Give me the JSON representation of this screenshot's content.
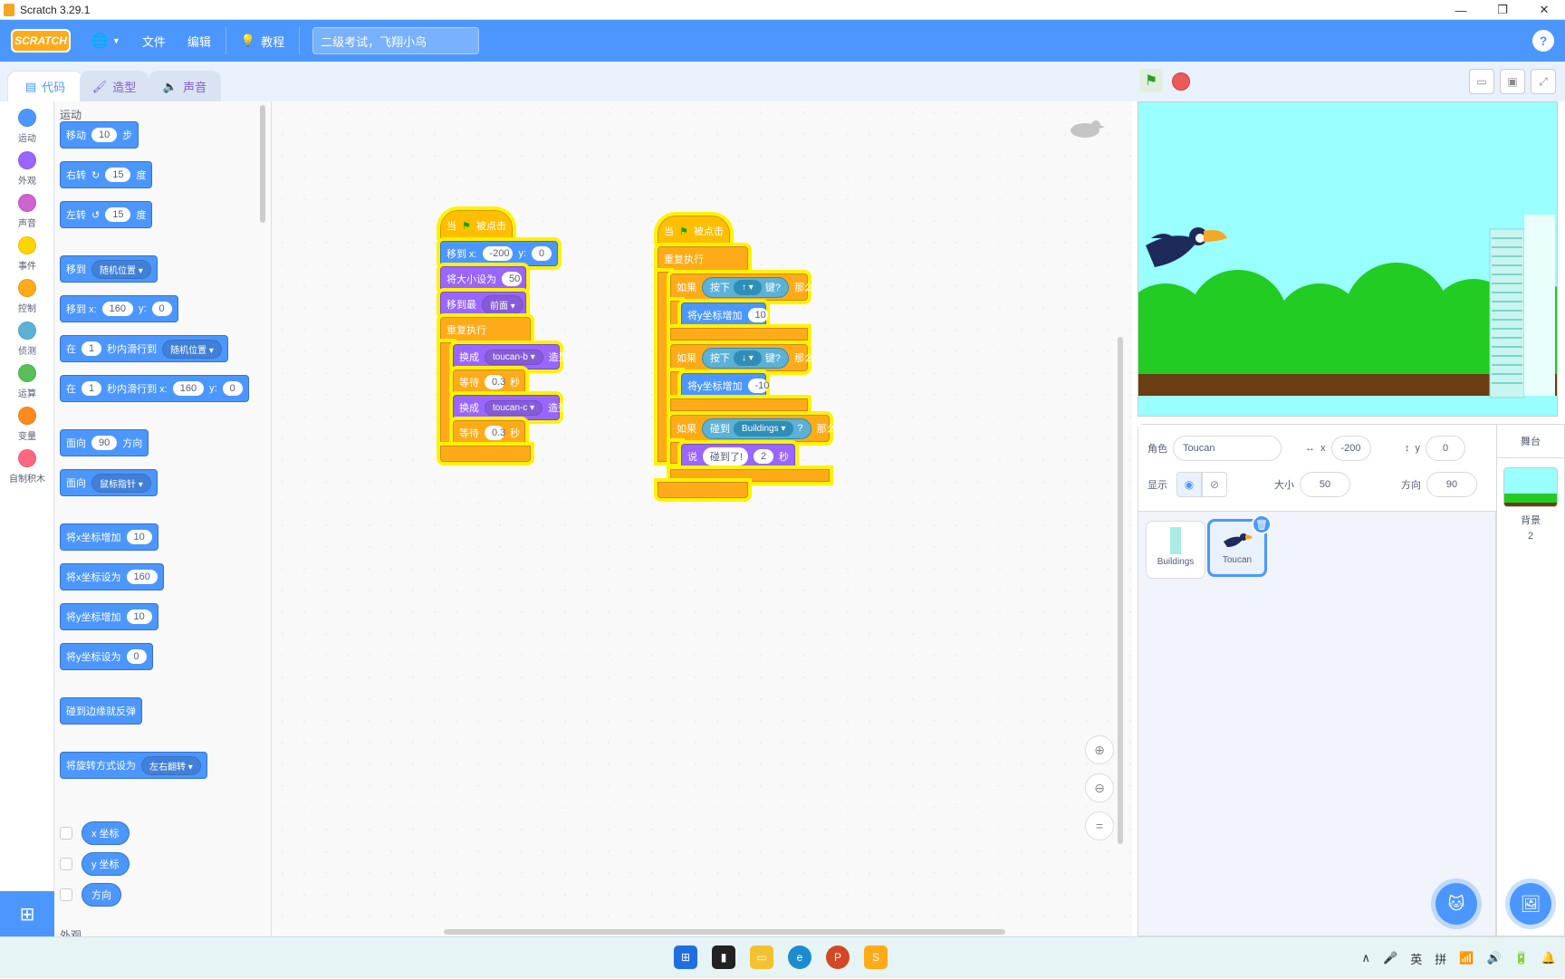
{
  "window": {
    "title": "Scratch 3.29.1",
    "controls": [
      "—",
      "❐",
      "✕"
    ]
  },
  "menubar": {
    "logo": "SCRATCH",
    "language_icon": "globe-icon",
    "file": "文件",
    "edit": "编辑",
    "tutorials": "教程",
    "project_title": "二级考试，飞翔小鸟",
    "help": "?"
  },
  "tabs": {
    "code": "代码",
    "costumes": "造型",
    "sounds": "声音"
  },
  "categories": [
    {
      "label": "运动",
      "color": "#4c97ff"
    },
    {
      "label": "外观",
      "color": "#9966ff"
    },
    {
      "label": "声音",
      "color": "#cf63cf"
    },
    {
      "label": "事件",
      "color": "#ffd500"
    },
    {
      "label": "控制",
      "color": "#ffab19"
    },
    {
      "label": "侦测",
      "color": "#5cb1d6"
    },
    {
      "label": "运算",
      "color": "#59c059"
    },
    {
      "label": "变量",
      "color": "#ff8c1a"
    },
    {
      "label": "自制积木",
      "color": "#ff6680"
    }
  ],
  "palette": {
    "heading": "运动",
    "move": {
      "pre": "移动",
      "val": "10",
      "post": "步"
    },
    "turn_right": {
      "pre": "右转",
      "val": "15",
      "post": "度"
    },
    "turn_left": {
      "pre": "左转",
      "val": "15",
      "post": "度"
    },
    "goto": {
      "pre": "移到",
      "drop": "随机位置"
    },
    "goto_xy": {
      "pre": "移到 x:",
      "x": "160",
      "mid": "y:",
      "y": "0"
    },
    "glide": {
      "pre": "在",
      "val": "1",
      "mid": "秒内滑行到",
      "drop": "随机位置"
    },
    "glide_xy": {
      "pre": "在",
      "val": "1",
      "mid": "秒内滑行到 x:",
      "x": "160",
      "ylab": "y:",
      "y": "0"
    },
    "point_dir": {
      "pre": "面向",
      "val": "90",
      "post": "方向"
    },
    "point_towards": {
      "pre": "面向",
      "drop": "鼠标指针"
    },
    "change_x": {
      "pre": "将x坐标增加",
      "val": "10"
    },
    "set_x": {
      "pre": "将x坐标设为",
      "val": "160"
    },
    "change_y": {
      "pre": "将y坐标增加",
      "val": "10"
    },
    "set_y": {
      "pre": "将y坐标设为",
      "val": "0"
    },
    "bounce": "碰到边缘就反弹",
    "rotation_style": {
      "pre": "将旋转方式设为",
      "drop": "左右翻转"
    },
    "rep_x": "x 坐标",
    "rep_y": "y 坐标",
    "rep_dir": "方向",
    "next_heading": "外观"
  },
  "script1": {
    "hat": {
      "pre": "当",
      "post": "被点击"
    },
    "goto": {
      "pre": "移到 x:",
      "x": "-200",
      "mid": "y:",
      "y": "0"
    },
    "size": {
      "pre": "将大小设为",
      "val": "50"
    },
    "layer": {
      "pre": "移到最",
      "drop": "前面"
    },
    "forever": "重复执行",
    "costume1": {
      "pre": "换成",
      "drop": "toucan-b",
      "post": "造型"
    },
    "wait1": {
      "pre": "等待",
      "val": "0.3",
      "post": "秒"
    },
    "costume2": {
      "pre": "换成",
      "drop": "toucan-c",
      "post": "造型"
    },
    "wait2": {
      "pre": "等待",
      "val": "0.3",
      "post": "秒"
    }
  },
  "script2": {
    "hat": {
      "pre": "当",
      "post": "被点击"
    },
    "forever": "重复执行",
    "if1": {
      "pre": "如果",
      "cond_pre": "按下",
      "key": "↑",
      "cond_post": "键?",
      "post": "那么"
    },
    "change_y1": {
      "pre": "将y坐标增加",
      "val": "10"
    },
    "if2": {
      "pre": "如果",
      "cond_pre": "按下",
      "key": "↓",
      "cond_post": "键?",
      "post": "那么"
    },
    "change_y2": {
      "pre": "将y坐标增加",
      "val": "-10"
    },
    "if3": {
      "pre": "如果",
      "cond_pre": "碰到",
      "target": "Buildings",
      "cond_post": "?",
      "post": "那么"
    },
    "say": {
      "pre": "说",
      "msg": "碰到了!",
      "val": "2",
      "post": "秒"
    }
  },
  "sprite_info": {
    "sprite_label": "角色",
    "sprite_name": "Toucan",
    "x_label": "x",
    "x_val": "-200",
    "y_label": "y",
    "y_val": "0",
    "show_label": "显示",
    "size_label": "大小",
    "size_val": "50",
    "dir_label": "方向",
    "dir_val": "90"
  },
  "sprites": [
    {
      "name": "Buildings",
      "selected": false
    },
    {
      "name": "Toucan",
      "selected": true
    }
  ],
  "stage_selector": {
    "title": "舞台",
    "backdrops_label": "背景",
    "backdrops_count": "2"
  },
  "taskbar": {
    "tray": [
      "∧",
      "🎤",
      "英",
      "拼",
      "📶",
      "🔊",
      "🔋",
      "🔔"
    ]
  }
}
